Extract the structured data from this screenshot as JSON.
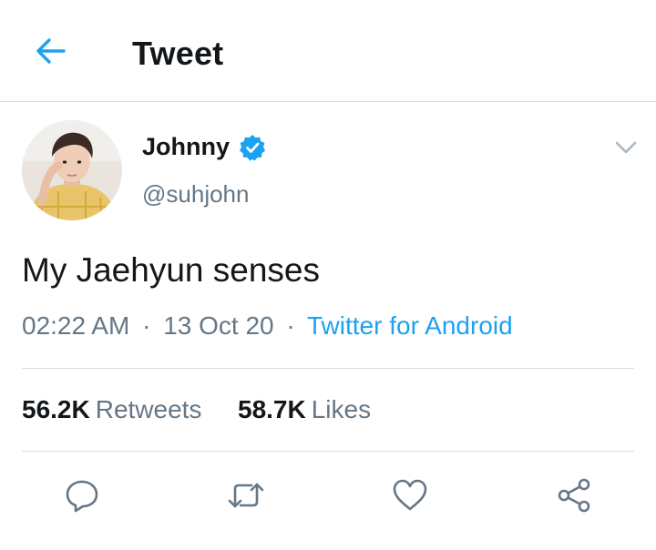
{
  "header": {
    "title": "Tweet",
    "back_icon": "arrow-left-icon"
  },
  "tweet": {
    "author_name": "Johnny",
    "handle": "@suhjohn",
    "verified": true,
    "text": "My Jaehyun senses",
    "time": "02:22 AM",
    "date": "13 Oct 20",
    "separator": "·",
    "source": "Twitter for Android"
  },
  "stats": {
    "retweets_count": "56.2K",
    "retweets_label": "Retweets",
    "likes_count": "58.7K",
    "likes_label": "Likes"
  },
  "actions": [
    "reply-icon",
    "retweet-icon",
    "like-icon",
    "share-icon"
  ],
  "colors": {
    "accent": "#1da1f2",
    "text": "#14171a",
    "muted": "#657786",
    "divider": "#d6dde3"
  }
}
